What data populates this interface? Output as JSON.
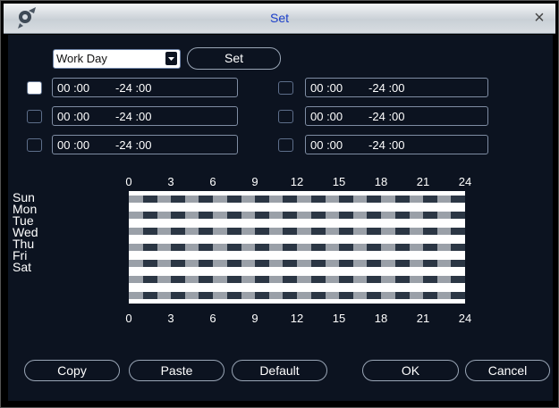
{
  "window": {
    "title": "Set",
    "close_symbol": "×"
  },
  "mode_select": {
    "value": "Work Day"
  },
  "set_button": {
    "label": "Set"
  },
  "periods": [
    {
      "enabled": true,
      "text": "00 :00        -24 :00"
    },
    {
      "enabled": false,
      "text": "00 :00        -24 :00"
    },
    {
      "enabled": false,
      "text": "00 :00        -24 :00"
    },
    {
      "enabled": false,
      "text": "00 :00        -24 :00"
    },
    {
      "enabled": false,
      "text": "00 :00        -24 :00"
    },
    {
      "enabled": false,
      "text": "00 :00        -24 :00"
    }
  ],
  "timeline": {
    "days": [
      "Sun",
      "Mon",
      "Tue",
      "Wed",
      "Thu",
      "Fri",
      "Sat"
    ],
    "hours": [
      "0",
      "3",
      "6",
      "9",
      "12",
      "15",
      "18",
      "21",
      "24"
    ],
    "fill_fraction": 1.0
  },
  "buttons": {
    "copy": "Copy",
    "paste": "Paste",
    "default": "Default",
    "ok": "OK",
    "cancel": "Cancel"
  },
  "colors": {
    "background": "#0c1320",
    "field_border": "#7f8da3",
    "title_text": "#1a3ec9",
    "grid_white": "#ffffff",
    "grid_band": "#9aa0a8",
    "grid_dark": "#2b3644"
  }
}
